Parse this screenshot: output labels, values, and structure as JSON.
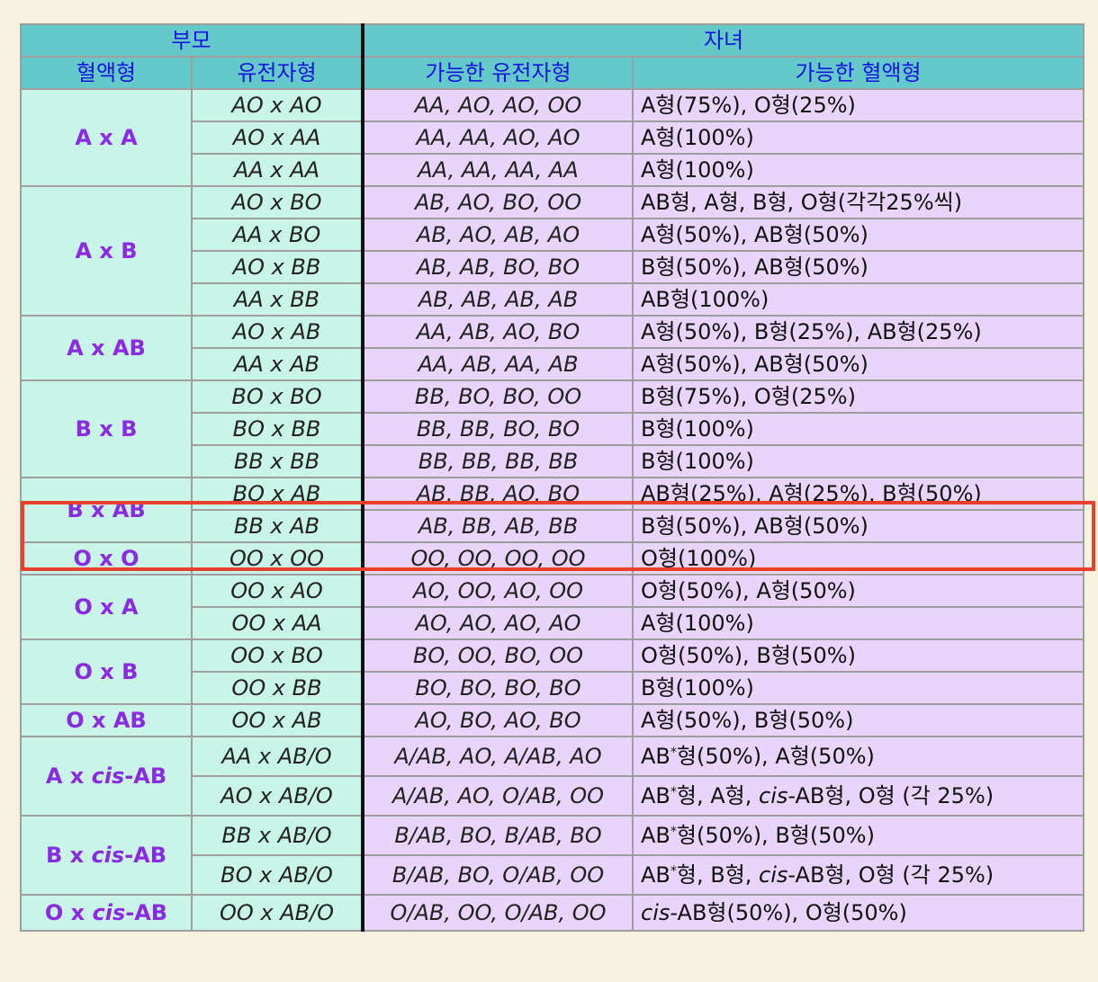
{
  "headers": {
    "parents": "부모",
    "children": "자녀",
    "blood_type": "혈액형",
    "genotype": "유전자형",
    "possible_genotype": "가능한 유전자형",
    "possible_blood_type": "가능한 혈액형"
  },
  "groups": [
    {
      "label": "A x A",
      "rows": [
        {
          "p": "AO x AO",
          "g": "AA, AO, AO, OO",
          "t": "A형(75%), O형(25%)"
        },
        {
          "p": "AO x AA",
          "g": "AA, AA, AO, AO",
          "t": "A형(100%)"
        },
        {
          "p": "AA x AA",
          "g": "AA, AA, AA, AA",
          "t": "A형(100%)"
        }
      ]
    },
    {
      "label": "A x B",
      "rows": [
        {
          "p": "AO x BO",
          "g": "AB, AO, BO, OO",
          "t": "AB형, A형, B형, O형(각각25%씩)"
        },
        {
          "p": "AA x BO",
          "g": "AB, AO, AB, AO",
          "t": "A형(50%), AB형(50%)"
        },
        {
          "p": "AO x BB",
          "g": "AB, AB, BO, BO",
          "t": "B형(50%), AB형(50%)"
        },
        {
          "p": "AA x BB",
          "g": "AB, AB, AB, AB",
          "t": "AB형(100%)"
        }
      ]
    },
    {
      "label": "A x AB",
      "rows": [
        {
          "p": "AO x AB",
          "g": "AA, AB, AO, BO",
          "t": "A형(50%), B형(25%), AB형(25%)"
        },
        {
          "p": "AA x AB",
          "g": "AA, AB, AA, AB",
          "t": "A형(50%), AB형(50%)"
        }
      ]
    },
    {
      "label": "B x B",
      "rows": [
        {
          "p": "BO x BO",
          "g": "BB, BO, BO, OO",
          "t": "B형(75%), O형(25%)"
        },
        {
          "p": "BO x BB",
          "g": "BB, BB, BO, BO",
          "t": "B형(100%)"
        },
        {
          "p": "BB x BB",
          "g": "BB, BB, BB, BB",
          "t": "B형(100%)"
        }
      ]
    },
    {
      "label": "B x AB",
      "rows": [
        {
          "p": "BO x AB",
          "g": "AB, BB, AO, BO",
          "t": "AB형(25%), A형(25%), B형(50%)"
        },
        {
          "p": "BB x AB",
          "g": "AB, BB, AB, BB",
          "t": "B형(50%), AB형(50%)"
        }
      ]
    },
    {
      "label": "O x O",
      "rows": [
        {
          "p": "OO x OO",
          "g": "OO, OO, OO, OO",
          "t": "O형(100%)"
        }
      ]
    },
    {
      "label": "O x A",
      "rows": [
        {
          "p": "OO x AO",
          "g": "AO, OO, AO, OO",
          "t": "O형(50%), A형(50%)"
        },
        {
          "p": "OO x AA",
          "g": "AO, AO, AO, AO",
          "t": "A형(100%)"
        }
      ]
    },
    {
      "label": "O x B",
      "rows": [
        {
          "p": "OO x BO",
          "g": "BO, OO, BO, OO",
          "t": "O형(50%), B형(50%)"
        },
        {
          "p": "OO x BB",
          "g": "BO, BO, BO, BO",
          "t": "B형(100%)"
        }
      ]
    },
    {
      "label": "O x AB",
      "rows": [
        {
          "p": "OO x AB",
          "g": "AO, BO, AO, BO",
          "t": "A형(50%), B형(50%)"
        }
      ]
    }
  ],
  "cis": {
    "cis_word": "cis",
    "a_prefix": "A x ",
    "b_prefix": "B x ",
    "o_prefix": "O x ",
    "ab_suffix": "-AB",
    "ab_star": "AB",
    "star": "*",
    "rows": [
      {
        "p": "AA x AB/O",
        "g": "A/AB, AO, A/AB, AO",
        "t_rest": "형(50%), A형(50%)"
      },
      {
        "p": "AO x AB/O",
        "g": "A/AB, AO, O/AB, OO",
        "t_rest": "형, A형, ",
        "t_tail": "-AB형, O형 (각 25%)"
      },
      {
        "p": "BB x AB/O",
        "g": "B/AB, BO, B/AB, BO",
        "t_rest": "형(50%), B형(50%)"
      },
      {
        "p": "BO x AB/O",
        "g": "B/AB, BO, O/AB, OO",
        "t_rest": "형, B형, ",
        "t_tail": "-AB형, O형 (각 25%)"
      },
      {
        "p": "OO x AB/O",
        "g": "O/AB, OO, O/AB, OO",
        "t_tail": "-AB형(50%), O형(50%)"
      }
    ]
  }
}
